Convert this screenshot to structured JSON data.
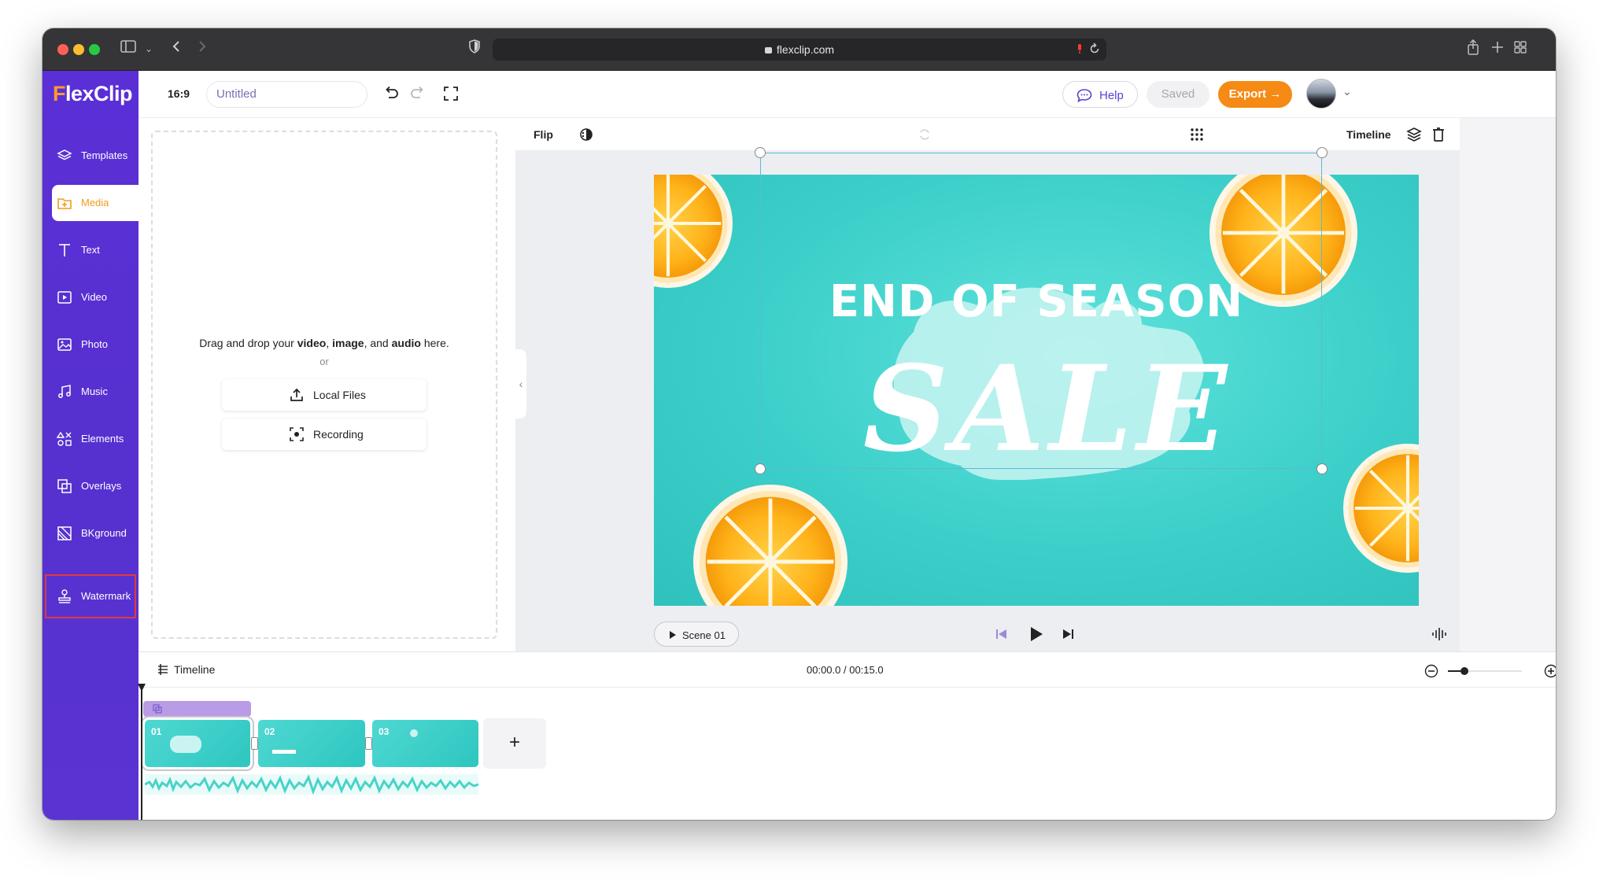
{
  "browser": {
    "url": "flexclip.com"
  },
  "app": {
    "logo": "FlexClip",
    "ratio": "16:9",
    "title_placeholder": "Untitled",
    "help_label": "Help",
    "saved_label": "Saved",
    "export_label": "Export →"
  },
  "sidebar": {
    "items": [
      {
        "label": "Templates",
        "icon": "layers-icon"
      },
      {
        "label": "Media",
        "icon": "folder-icon"
      },
      {
        "label": "Text",
        "icon": "text-icon"
      },
      {
        "label": "Video",
        "icon": "video-icon"
      },
      {
        "label": "Photo",
        "icon": "photo-icon"
      },
      {
        "label": "Music",
        "icon": "music-icon"
      },
      {
        "label": "Elements",
        "icon": "elements-icon"
      },
      {
        "label": "Overlays",
        "icon": "overlays-icon"
      },
      {
        "label": "BKground",
        "icon": "background-icon"
      },
      {
        "label": "Watermark",
        "icon": "stamp-icon"
      }
    ],
    "active": "Media"
  },
  "media_panel": {
    "drop_prefix": "Drag and drop your",
    "drop_video": "video",
    "drop_image": "image",
    "drop_and": ", and",
    "drop_audio": "audio",
    "drop_suffix": "here.",
    "or": "or",
    "local_files": "Local Files",
    "recording": "Recording"
  },
  "canvas": {
    "flip_label": "Flip",
    "timeline_label": "Timeline",
    "headline": "END OF SEASON",
    "subheadline": "SALE",
    "scene_label": "Scene 01",
    "colors": {
      "background": "#3ccfc9",
      "accent": "#f58a14",
      "brand": "#5b2fd6"
    }
  },
  "timeline": {
    "title": "Timeline",
    "time": "00:00.0 / 00:15.0",
    "clips": [
      "01",
      "02",
      "03"
    ],
    "add_label": "+"
  }
}
